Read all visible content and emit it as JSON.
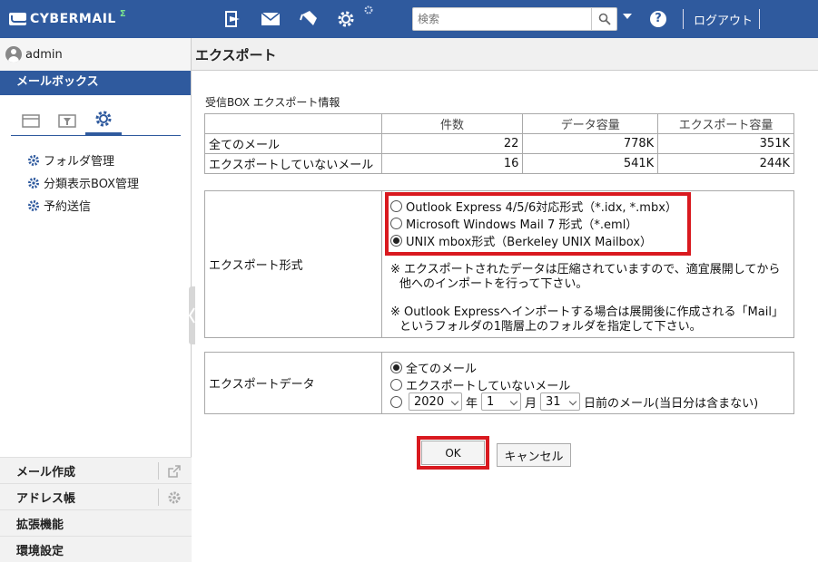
{
  "header": {
    "logo_text": "CYBERMAIL",
    "logo_suffix": "Σ",
    "search_placeholder": "検索",
    "logout_label": "ログアウト"
  },
  "sidebar": {
    "username": "admin",
    "section_title": "メールボックス",
    "menu_items": [
      "フォルダ管理",
      "分類表示BOX管理",
      "予約送信"
    ],
    "bottom_items": [
      "メール作成",
      "アドレス帳",
      "拡張機能",
      "環境設定"
    ]
  },
  "main": {
    "page_title": "エクスポート",
    "info_title": "受信BOX エクスポート情報",
    "info_table": {
      "headers": [
        "",
        "件数",
        "データ容量",
        "エクスポート容量"
      ],
      "rows": [
        [
          "全てのメール",
          "22",
          "778K",
          "351K"
        ],
        [
          "エクスポートしていないメール",
          "16",
          "541K",
          "244K"
        ]
      ]
    },
    "format_label": "エクスポート形式",
    "format_options": [
      {
        "label": "Outlook Express 4/5/6対応形式（*.idx, *.mbx）",
        "selected": false
      },
      {
        "label": "Microsoft Windows Mail 7 形式（*.eml）",
        "selected": false
      },
      {
        "label": "UNIX mbox形式（Berkeley UNIX Mailbox）",
        "selected": true
      }
    ],
    "note1_line1": "※ エクスポートされたデータは圧縮されていますので、適宜展開してから",
    "note1_line2": "他へのインポートを行って下さい。",
    "note2_line1": "※ Outlook Expressへインポートする場合は展開後に作成される「Mail」",
    "note2_line2": "というフォルダの1階層上のフォルダを指定して下さい。",
    "data_label": "エクスポートデータ",
    "data_options": [
      {
        "label": "全てのメール",
        "selected": true
      },
      {
        "label": "エクスポートしていないメール",
        "selected": false
      }
    ],
    "date_option": {
      "selected": false,
      "year": "2020",
      "year_unit": "年",
      "month": "1",
      "month_unit": "月",
      "day": "31",
      "suffix": "日前のメール(当日分は含まない)"
    },
    "ok_label": "OK",
    "cancel_label": "キャンセル"
  },
  "colors": {
    "header_bg": "#2f5a9e",
    "highlight": "#d9191f"
  }
}
